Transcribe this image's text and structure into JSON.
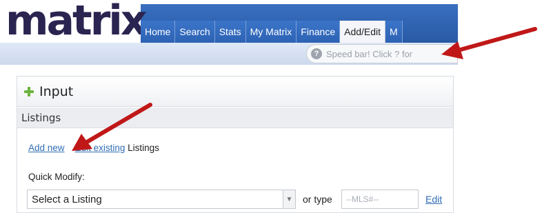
{
  "app": {
    "logo_text": "matrix"
  },
  "nav": {
    "tabs": [
      "Home",
      "Search",
      "Stats",
      "My Matrix",
      "Finance",
      "Add/Edit",
      "M"
    ],
    "active_tab": "Add/Edit"
  },
  "speedbar": {
    "text": "Speed bar! Click ? for",
    "icon": "question-icon"
  },
  "panel": {
    "title": "Input",
    "icon": "plus-icon",
    "section": "Listings",
    "links": {
      "add_new": "Add new",
      "edit_existing": "Edit existing",
      "suffix": "Listings"
    },
    "quick_modify_label": "Quick Modify:",
    "select_value": "Select a Listing",
    "or_type_label": "or type",
    "mls_placeholder": "--MLS#--",
    "edit_label": "Edit"
  },
  "colors": {
    "nav_blue": "#2f63b2",
    "accent_link": "#2f6db5",
    "annotation_arrow": "#c01818",
    "plus_green": "#6cb33f"
  }
}
